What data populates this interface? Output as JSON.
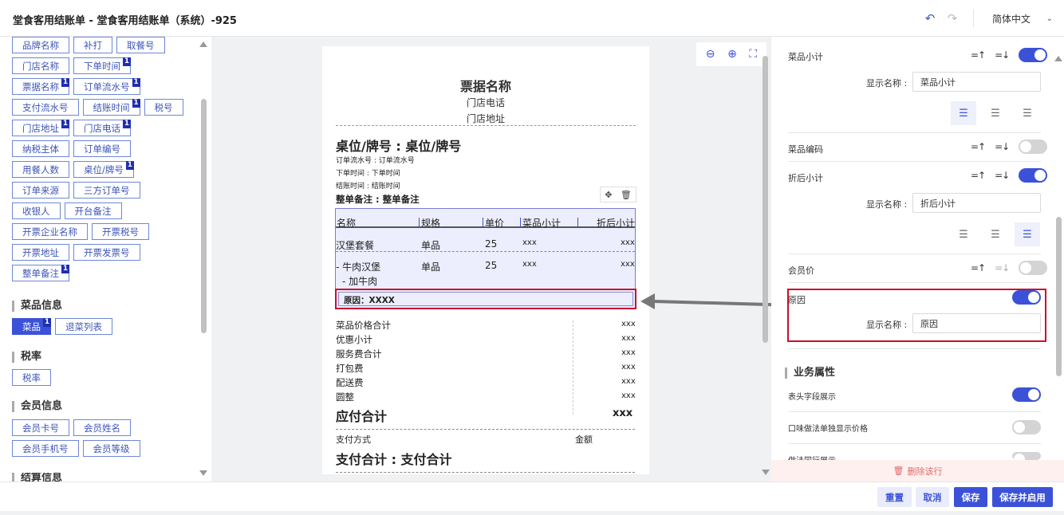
{
  "header": {
    "title": "堂食客用结账单 - 堂食客用结账单（系统）-925",
    "language": "简体中文"
  },
  "left_panel": {
    "field_rows": [
      [
        {
          "label": "品牌名称",
          "badge": ""
        },
        {
          "label": "补打",
          "badge": ""
        },
        {
          "label": "取餐号",
          "badge": ""
        }
      ],
      [
        {
          "label": "门店名称",
          "badge": ""
        },
        {
          "label": "下单时间",
          "badge": "1"
        }
      ],
      [
        {
          "label": "票据名称",
          "badge": "1"
        },
        {
          "label": "订单流水号",
          "badge": "1"
        }
      ],
      [
        {
          "label": "支付流水号",
          "badge": ""
        },
        {
          "label": "结账时间",
          "badge": "1"
        },
        {
          "label": "税号",
          "badge": ""
        }
      ],
      [
        {
          "label": "门店地址",
          "badge": "1"
        },
        {
          "label": "门店电话",
          "badge": "1"
        }
      ],
      [
        {
          "label": "纳税主体",
          "badge": ""
        },
        {
          "label": "订单编号",
          "badge": ""
        }
      ],
      [
        {
          "label": "用餐人数",
          "badge": ""
        },
        {
          "label": "桌位/牌号",
          "badge": "1"
        }
      ],
      [
        {
          "label": "订单来源",
          "badge": ""
        },
        {
          "label": "三方订单号",
          "badge": ""
        }
      ],
      [
        {
          "label": "收银人",
          "badge": ""
        },
        {
          "label": "开台备注",
          "badge": ""
        }
      ],
      [
        {
          "label": "开票企业名称",
          "badge": ""
        },
        {
          "label": "开票税号",
          "badge": ""
        }
      ],
      [
        {
          "label": "开票地址",
          "badge": ""
        },
        {
          "label": "开票发票号",
          "badge": ""
        }
      ],
      [
        {
          "label": "整单备注",
          "badge": "1"
        }
      ]
    ],
    "dish_section": {
      "title": "菜品信息",
      "items": [
        {
          "label": "菜品",
          "badge": "1"
        },
        {
          "label": "退菜列表",
          "badge": ""
        }
      ]
    },
    "tax_section": {
      "title": "税率",
      "items": [
        {
          "label": "税率",
          "badge": ""
        }
      ]
    },
    "member_section": {
      "title": "会员信息",
      "items": [
        {
          "label": "会员卡号"
        },
        {
          "label": "会员姓名"
        },
        {
          "label": "会员手机号"
        },
        {
          "label": "会员等级"
        }
      ]
    },
    "settle_section": {
      "title": "结算信息"
    }
  },
  "receipt": {
    "title": "票据名称",
    "phone": "门店电话",
    "address": "门店地址",
    "table": "桌位/牌号 : 桌位/牌号",
    "serial": "订单流水号 : 订单流水号",
    "order_time": "下单时间 : 下单时间",
    "pay_time": "结账时间 : 结账时间",
    "remark": "整单备注 : 整单备注",
    "columns": [
      "名称",
      "规格",
      "单价",
      "菜品小计",
      "折后小计"
    ],
    "rows": [
      {
        "name": "汉堡套餐",
        "spec": "单品",
        "price": "25",
        "subtotal": "xxx",
        "discount": "xxx"
      },
      {
        "name": "- 牛肉汉堡",
        "spec": "单品",
        "price": "25",
        "subtotal": "xxx",
        "discount": "xxx",
        "sub": "- 加牛肉"
      }
    ],
    "reason": "原因：XXXX",
    "totals": [
      {
        "label": "菜品价格合计",
        "value": "xxx"
      },
      {
        "label": "优惠小计",
        "value": "xxx"
      },
      {
        "label": "服务费合计",
        "value": "xxx"
      },
      {
        "label": "打包费",
        "value": "xxx"
      },
      {
        "label": "配送费",
        "value": "xxx"
      },
      {
        "label": "圆整",
        "value": "xxx"
      }
    ],
    "payable_label": "应付合计",
    "payable_value": "xxx",
    "pay_method_label": "支付方式",
    "amount_label": "金额",
    "paid_total": "支付合计 : 支付合计"
  },
  "right_panel": {
    "dish_subtotal": {
      "label": "菜品小计",
      "display_label": "显示名称 :",
      "display_value": "菜品小计",
      "on": true
    },
    "dish_code": {
      "label": "菜品编码",
      "on": false
    },
    "discount_subtotal": {
      "label": "折后小计",
      "display_label": "显示名称 :",
      "display_value": "折后小计",
      "on": true
    },
    "member_price": {
      "label": "会员价",
      "on": false
    },
    "reason": {
      "label": "原因",
      "display_label": "显示名称 :",
      "display_value": "原因",
      "on": true
    },
    "business_section": "业务属性",
    "header_field": {
      "label": "表头字段展示",
      "on": true
    },
    "flavor": {
      "label": "口味做法单独显示价格",
      "on": false
    },
    "cut_row": {
      "label": "做法同行展示",
      "on": false
    },
    "delete_row": "删除该行"
  },
  "footer": {
    "reset": "重置",
    "cancel": "取消",
    "save": "保存",
    "save_enable": "保存并启用"
  },
  "colors": {
    "primary": "#3b52d8",
    "highlight_red": "#c8102e"
  }
}
